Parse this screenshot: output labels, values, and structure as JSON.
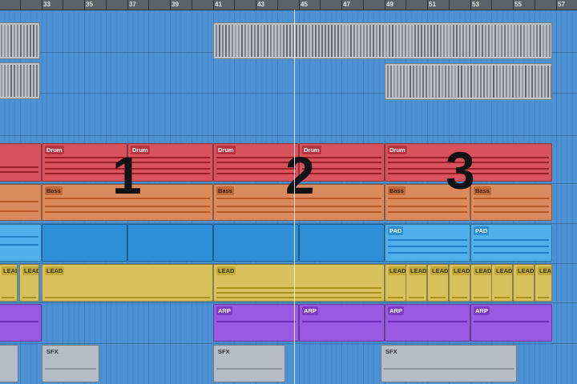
{
  "ruler": {
    "bar_numbers": [
      "33",
      "35",
      "37",
      "39",
      "41",
      "43",
      "45",
      "47",
      "49",
      "51",
      "53",
      "55",
      "57"
    ]
  },
  "sections": [
    "1",
    "2",
    "3"
  ],
  "tracks": {
    "drum": {
      "label": "Drum",
      "color": "#d7525d"
    },
    "bass": {
      "label": "Bass",
      "color": "#db8a5e"
    },
    "pad": {
      "label": "PAD",
      "color": "#4fb0ec"
    },
    "lead": {
      "label": "LEAD",
      "color": "#d9c25e"
    },
    "arp": {
      "label": "ARP",
      "color": "#9a59e3"
    },
    "sfx": {
      "label": "SFX",
      "color": "#b4bcc6"
    }
  },
  "colors": {
    "background": "#4d92d5",
    "ruler": "#5b6168",
    "audio_region": "#bfc3c8"
  }
}
